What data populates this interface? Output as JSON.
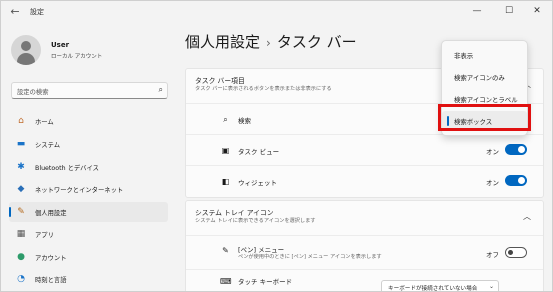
{
  "app_title": "設定",
  "window_controls": [
    "—",
    "☐",
    "✕"
  ],
  "user": {
    "name": "User",
    "account_type": "ローカル アカウント"
  },
  "search": {
    "placeholder": "設定の検索"
  },
  "sidebar": {
    "items": [
      {
        "label": "ホーム",
        "icon": "home-icon",
        "glyph": "⌂",
        "color": "#c06b2c"
      },
      {
        "label": "システム",
        "icon": "system-icon",
        "glyph": "▬",
        "color": "#1a73c8"
      },
      {
        "label": "Bluetooth とデバイス",
        "icon": "bluetooth-icon",
        "glyph": "✱",
        "color": "#1a73c8"
      },
      {
        "label": "ネットワークとインターネット",
        "icon": "network-icon",
        "glyph": "◆",
        "color": "#2a6fb8"
      },
      {
        "label": "個人用設定",
        "icon": "personalization-icon",
        "glyph": "✎",
        "color": "#b56a1c",
        "active": true
      },
      {
        "label": "アプリ",
        "icon": "apps-icon",
        "glyph": "▦",
        "color": "#555555"
      },
      {
        "label": "アカウント",
        "icon": "account-icon",
        "glyph": "●",
        "color": "#2d9b6a"
      },
      {
        "label": "時刻と言語",
        "icon": "time-language-icon",
        "glyph": "◔",
        "color": "#1a73c8"
      }
    ]
  },
  "breadcrumb": {
    "parent": "個人用設定",
    "separator": "›",
    "current": "タスク バー"
  },
  "taskbar_items_section": {
    "title": "タスク バー項目",
    "subtitle": "タスク バーに表示されるボタンを表示または非表示にする",
    "rows": [
      {
        "label": "検索",
        "icon": "search-icon",
        "glyph": "⌕"
      },
      {
        "label": "タスク ビュー",
        "icon": "task-view-icon",
        "glyph": "▣",
        "state": "オン",
        "toggle": true
      },
      {
        "label": "ウィジェット",
        "icon": "widgets-icon",
        "glyph": "◧",
        "state": "オン",
        "toggle": true
      }
    ]
  },
  "tray_section": {
    "title": "システム トレイ アイコン",
    "subtitle": "システム トレイに表示できるアイコンを選択します",
    "rows": [
      {
        "label": "[ペン] メニュー",
        "sub": "ペンが使用中のときに [ペン] メニュー アイコンを表示します",
        "icon": "pen-icon",
        "glyph": "✎",
        "state": "オフ",
        "toggle": false
      },
      {
        "label": "タッチ キーボード",
        "icon": "keyboard-icon",
        "glyph": "⌨",
        "dropdown": "キーボードが接続されていない場合"
      }
    ]
  },
  "search_mode_menu": {
    "options": [
      "非表示",
      "検索アイコンのみ",
      "検索アイコンとラベル",
      "検索ボックス"
    ],
    "selected": "検索ボックス"
  },
  "colors": {
    "accent": "#0067c0",
    "highlight": "#e01010"
  }
}
